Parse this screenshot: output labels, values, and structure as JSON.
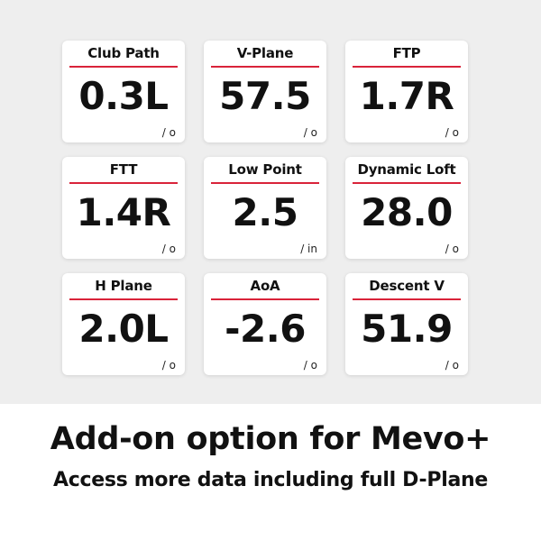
{
  "colors": {
    "accent": "#d9233a",
    "band_background": "#eeeeee",
    "card_background": "#ffffff",
    "text": "#111111"
  },
  "metrics": [
    {
      "label": "Club Path",
      "value": "0.3L",
      "unit": "/ o"
    },
    {
      "label": "V-Plane",
      "value": "57.5",
      "unit": "/ o"
    },
    {
      "label": "FTP",
      "value": "1.7R",
      "unit": "/ o"
    },
    {
      "label": "FTT",
      "value": "1.4R",
      "unit": "/ o"
    },
    {
      "label": "Low Point",
      "value": "2.5",
      "unit": "/ in"
    },
    {
      "label": "Dynamic Loft",
      "value": "28.0",
      "unit": "/ o"
    },
    {
      "label": "H Plane",
      "value": "2.0L",
      "unit": "/ o"
    },
    {
      "label": "AoA",
      "value": "-2.6",
      "unit": "/ o"
    },
    {
      "label": "Descent V",
      "value": "51.9",
      "unit": "/ o"
    }
  ],
  "footer": {
    "headline": "Add-on option for Mevo+",
    "subline": "Access more data including full D-Plane"
  }
}
